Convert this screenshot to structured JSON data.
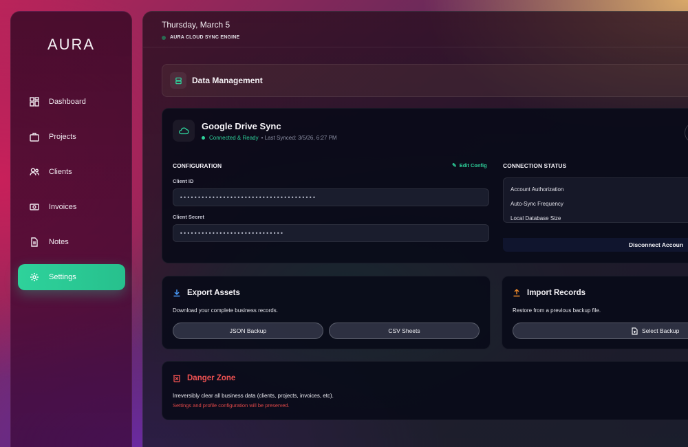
{
  "app": {
    "logo": "AURA"
  },
  "sidebar": {
    "items": [
      {
        "label": "Dashboard",
        "icon": "dashboard-icon",
        "active": false
      },
      {
        "label": "Projects",
        "icon": "briefcase-icon",
        "active": false
      },
      {
        "label": "Clients",
        "icon": "users-icon",
        "active": false
      },
      {
        "label": "Invoices",
        "icon": "money-icon",
        "active": false
      },
      {
        "label": "Notes",
        "icon": "document-icon",
        "active": false
      },
      {
        "label": "Settings",
        "icon": "gear-icon",
        "active": true
      }
    ]
  },
  "header": {
    "date": "Thursday, March 5",
    "subtitle": "AURA CLOUD SYNC ENGINE"
  },
  "section": {
    "title": "Data Management",
    "icon": "database-icon"
  },
  "drive_sync": {
    "title": "Google Drive Sync",
    "status": "Connected & Ready",
    "last_synced": "• Last Synced: 3/5/26, 6:27 PM",
    "config_title": "CONFIGURATION",
    "edit_label": "Edit Config",
    "client_id_label": "Client ID",
    "client_id_value": "••••••••••••••••••••••••••••••••••••••",
    "client_secret_label": "Client Secret",
    "client_secret_value": "•••••••••••••••••••••••••••••",
    "connection_title": "CONNECTION STATUS",
    "connection_rows": [
      "Account Authorization",
      "Auto-Sync Frequency",
      "Local Database Size"
    ],
    "disconnect_label": "Disconnect Accoun"
  },
  "export": {
    "title": "Export Assets",
    "description": "Download your complete business records.",
    "json_button": "JSON Backup",
    "csv_button": "CSV Sheets"
  },
  "import": {
    "title": "Import Records",
    "description": "Restore from a previous backup file.",
    "select_button": "Select Backup"
  },
  "danger": {
    "title": "Danger Zone",
    "description": "Irreversibly clear all business data (clients, projects, invoices, etc).",
    "note": "Settings and profile configuration will be preserved."
  },
  "colors": {
    "accent": "#2ed29b",
    "danger": "#f05252",
    "export_icon": "#4a9eff",
    "import_icon": "#f08a2a"
  }
}
